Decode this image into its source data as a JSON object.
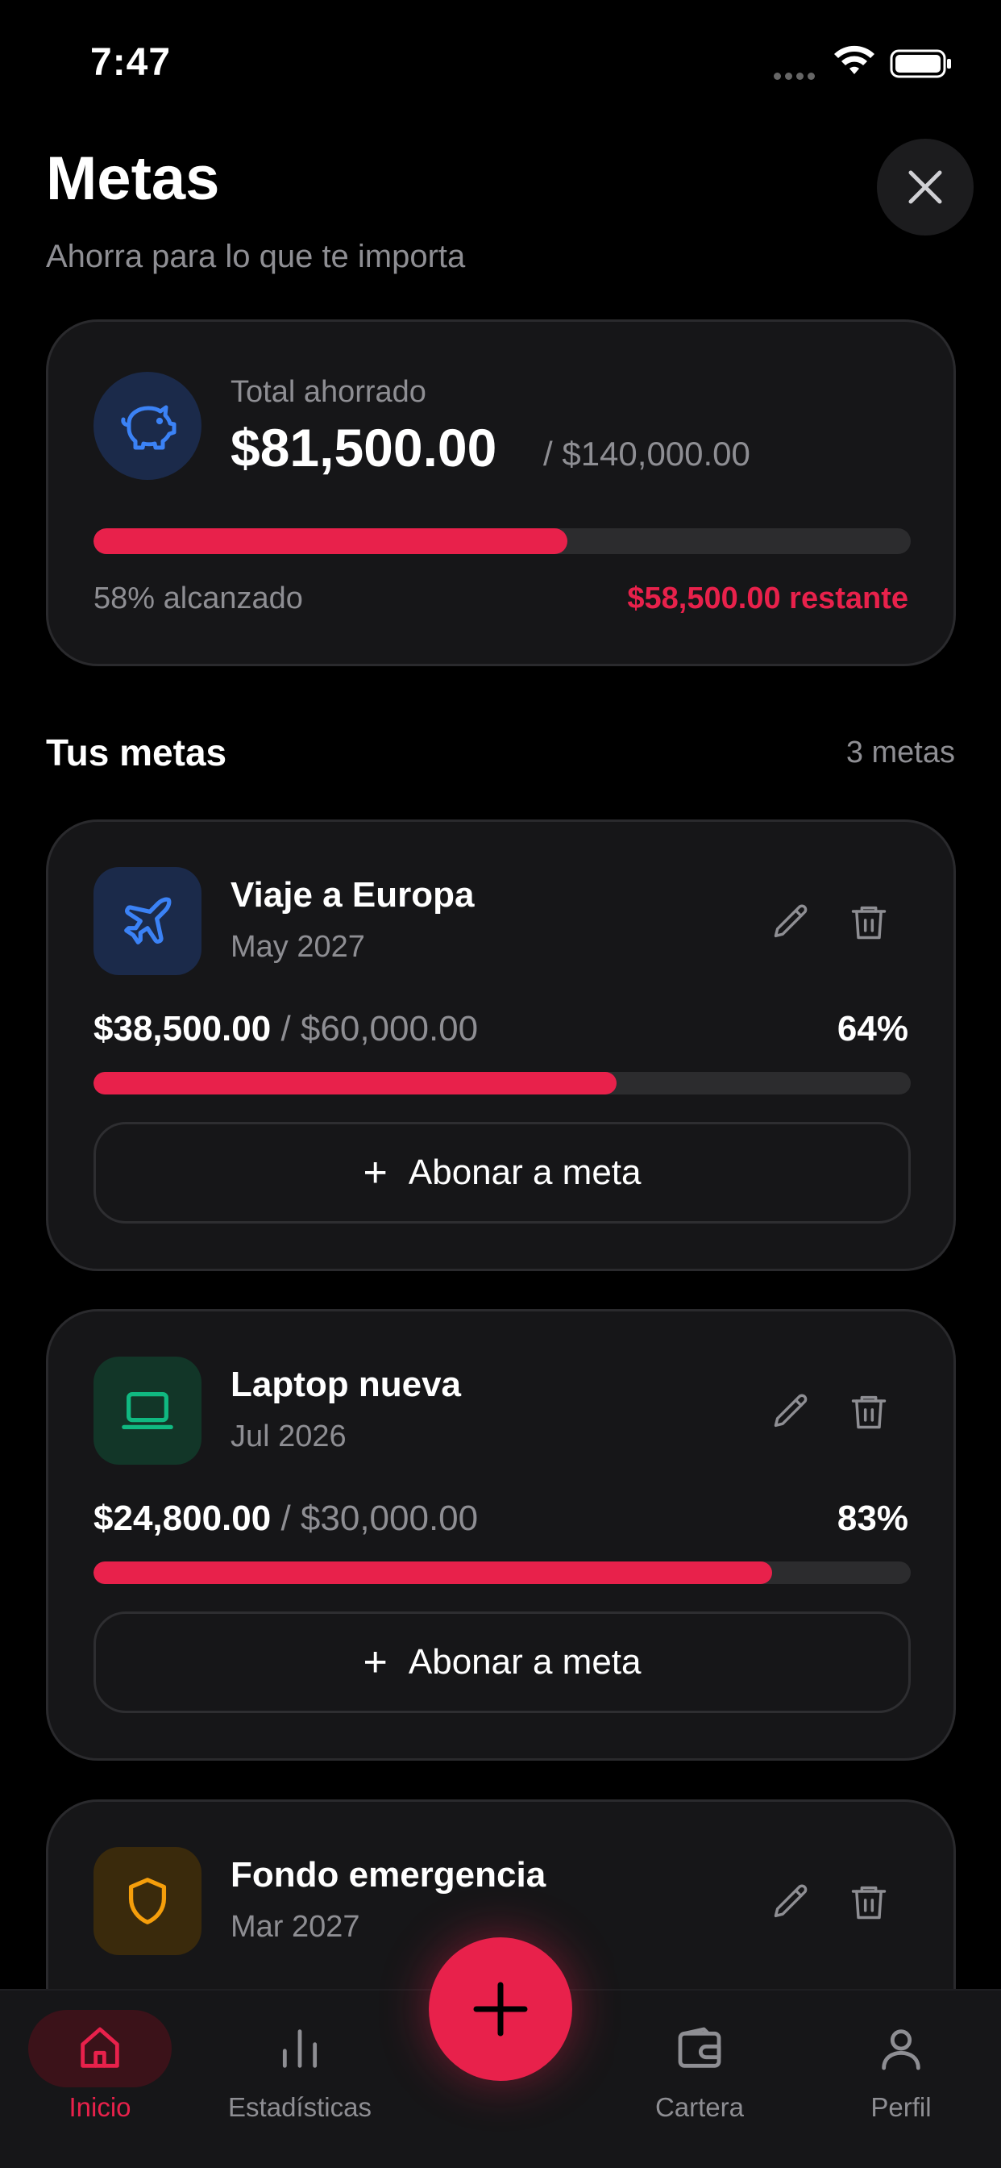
{
  "status_bar": {
    "time": "7:47"
  },
  "header": {
    "title": "Metas",
    "subtitle": "Ahorra para lo que te importa"
  },
  "summary": {
    "label": "Total ahorrado",
    "amount": "$81,500.00",
    "target": "/ $140,000.00",
    "progress": 0.58,
    "percent_text": "58% alcanzado",
    "remaining_text": "$58,500.00 restante"
  },
  "goals_section": {
    "title": "Tus metas",
    "count": "3 metas"
  },
  "goals": [
    {
      "name": "Viaje a Europa",
      "date": "May 2027",
      "current": "$38,500.00",
      "target": "/ $60,000.00",
      "percent": "64%",
      "progress": 0.64,
      "icon": "airplane-icon",
      "icon_color": "#3b82f6",
      "icon_bg": "#1b2a4a",
      "deposit_label": "Abonar a meta"
    },
    {
      "name": "Laptop nueva",
      "date": "Jul 2026",
      "current": "$24,800.00",
      "target": "/ $30,000.00",
      "percent": "83%",
      "progress": 0.83,
      "icon": "laptop-icon",
      "icon_color": "#10b981",
      "icon_bg": "#123628",
      "deposit_label": "Abonar a meta"
    },
    {
      "name": "Fondo emergencia",
      "date": "Mar 2027",
      "icon": "shield-icon",
      "icon_color": "#f59e0b",
      "icon_bg": "#3a2a0c"
    }
  ],
  "tab_bar": {
    "tabs": [
      {
        "label": "Inicio",
        "icon": "home-icon",
        "active": true
      },
      {
        "label": "Estadísticas",
        "icon": "bar-chart-icon",
        "active": false
      },
      {
        "label": "Cartera",
        "icon": "wallet-icon",
        "active": false
      },
      {
        "label": "Perfil",
        "icon": "user-icon",
        "active": false
      }
    ],
    "fab_icon": "plus-icon"
  },
  "colors": {
    "accent": "#e8214b",
    "background": "#000000",
    "card": "#161618",
    "muted": "#8e8e93"
  }
}
